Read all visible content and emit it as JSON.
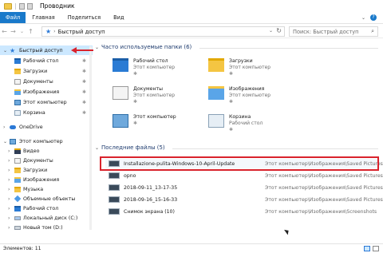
{
  "window": {
    "title": "Проводник"
  },
  "ribbon": {
    "tabs": [
      "Файл",
      "Главная",
      "Поделиться",
      "Вид"
    ]
  },
  "address": {
    "location": "Быстрый доступ",
    "search_placeholder": "Поиск: Быстрый доступ"
  },
  "sidebar": {
    "items": [
      {
        "label": "Быстрый доступ",
        "icon": "star-icon",
        "pinned": false,
        "selected": true
      },
      {
        "label": "Рабочий стол",
        "icon": "desktop-folder-icon",
        "pinned": true
      },
      {
        "label": "Загрузки",
        "icon": "downloads-folder-icon",
        "pinned": true
      },
      {
        "label": "Документы",
        "icon": "documents-folder-icon",
        "pinned": true
      },
      {
        "label": "Изображения",
        "icon": "pictures-folder-icon",
        "pinned": true
      },
      {
        "label": "Этот компьютер",
        "icon": "computer-icon",
        "pinned": true
      },
      {
        "label": "Корзина",
        "icon": "recycle-bin-icon",
        "pinned": true
      },
      {
        "label": "OneDrive",
        "icon": "onedrive-icon"
      },
      {
        "label": "Этот компьютер",
        "icon": "computer-icon"
      },
      {
        "label": "Видео",
        "icon": "videos-folder-icon"
      },
      {
        "label": "Документы",
        "icon": "documents-folder-icon"
      },
      {
        "label": "Загрузки",
        "icon": "downloads-folder-icon"
      },
      {
        "label": "Изображения",
        "icon": "pictures-folder-icon"
      },
      {
        "label": "Музыка",
        "icon": "music-folder-icon"
      },
      {
        "label": "Объемные объекты",
        "icon": "3d-objects-icon"
      },
      {
        "label": "Рабочий стол",
        "icon": "desktop-folder-icon"
      },
      {
        "label": "Локальный диск (C:)",
        "icon": "windows-drive-icon"
      },
      {
        "label": "Новый том (D:)",
        "icon": "drive-icon"
      }
    ]
  },
  "frequent": {
    "header": "Часто используемые папки (6)",
    "folders": [
      {
        "name": "Рабочий стол",
        "location": "Этот компьютер",
        "icon": "desktop-folder-icon"
      },
      {
        "name": "Загрузки",
        "location": "Этот компьютер",
        "icon": "downloads-folder-icon"
      },
      {
        "name": "Документы",
        "location": "Этот компьютер",
        "icon": "documents-folder-icon"
      },
      {
        "name": "Изображения",
        "location": "Этот компьютер",
        "icon": "pictures-folder-icon"
      },
      {
        "name": "Этот компьютер",
        "location": "",
        "icon": "computer-icon"
      },
      {
        "name": "Корзина",
        "location": "Рабочий стол",
        "icon": "recycle-bin-icon"
      }
    ]
  },
  "recent": {
    "header": "Последние файлы (5)",
    "files": [
      {
        "name": "Installazione-pulita-Windows-10-April-Update",
        "path": "Этот компьютер\\Изображения\\Saved Pictures"
      },
      {
        "name": "opno",
        "path": "Этот компьютер\\Изображения\\Saved Pictures"
      },
      {
        "name": "2018-09-11_13-17-35",
        "path": "Этот компьютер\\Изображения\\Saved Pictures"
      },
      {
        "name": "2018-09-16_15-16-33",
        "path": "Этот компьютер\\Изображения\\Saved Pictures"
      },
      {
        "name": "Снимок экрана (10)",
        "path": "Этот компьютер\\Изображения\\Screenshots"
      }
    ]
  },
  "status": {
    "count": "Элементов: 11"
  },
  "colors": {
    "accent": "#1979ca",
    "selection": "#cce8ff",
    "annotation": "#d9232d"
  }
}
